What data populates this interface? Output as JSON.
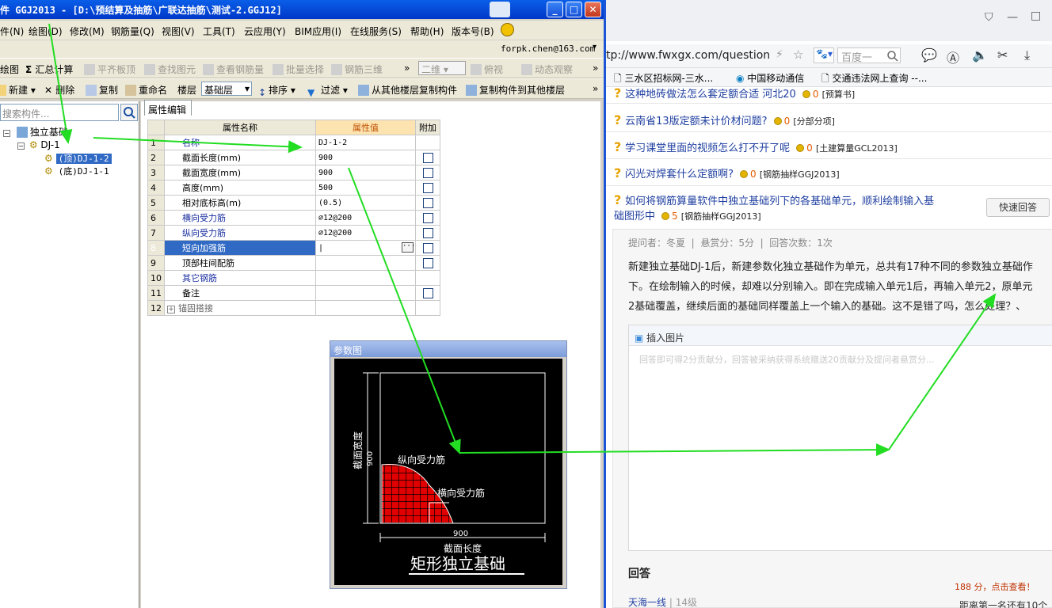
{
  "app": {
    "title": "件 GGJ2013 - [D:\\预结算及抽筋\\广联达抽筋\\测试-2.GGJ12]",
    "menu": [
      "件(N)",
      "绘图(D)",
      "修改(M)",
      "钢筋量(Q)",
      "视图(V)",
      "工具(T)",
      "云应用(Y)",
      "BIM应用(I)",
      "在线服务(S)",
      "帮助(H)",
      "版本号(B)"
    ],
    "account": "forpk.chen@163.com",
    "toolbar1": {
      "draw": "绘图",
      "summary_calc": "汇总计算",
      "flush_slab": "平齐板顶",
      "find_elem": "查找图元",
      "view_rebar": "查看钢筋量",
      "batch_select": "批量选择",
      "rebar_3d": "钢筋三维",
      "dim_mode": "二维",
      "view": "俯视",
      "dynamic_view": "动态观察"
    },
    "toolbar2": {
      "new": "新建",
      "delete": "删除",
      "copy": "复制",
      "rename": "重命名",
      "floor_label": "楼层",
      "floor_value": "基础层",
      "sort": "排序",
      "filter": "过滤",
      "copy_from_floor": "从其他楼层复制构件",
      "copy_to_floor": "复制构件到其他楼层"
    },
    "search_placeholder": "搜索构件...",
    "tree": {
      "root": "独立基础",
      "group": "DJ-1",
      "child1": "(顶)DJ-1-2",
      "child2": "(底)DJ-1-1"
    },
    "tab": "属性编辑",
    "table": {
      "headers": [
        "属性名称",
        "属性值",
        "附加"
      ],
      "rows": [
        {
          "no": "1",
          "name": "名称",
          "value": "DJ-1-2",
          "blue": true,
          "cb": false
        },
        {
          "no": "2",
          "name": "截面长度(mm)",
          "value": "900",
          "blue": false,
          "cb": true
        },
        {
          "no": "3",
          "name": "截面宽度(mm)",
          "value": "900",
          "blue": false,
          "cb": true
        },
        {
          "no": "4",
          "name": "高度(mm)",
          "value": "500",
          "blue": false,
          "cb": true
        },
        {
          "no": "5",
          "name": "相对底标高(m)",
          "value": "(0.5)",
          "blue": false,
          "cb": true
        },
        {
          "no": "6",
          "name": "横向受力筋",
          "value": "⌀12@200",
          "blue": true,
          "cb": true
        },
        {
          "no": "7",
          "name": "纵向受力筋",
          "value": "⌀12@200",
          "blue": true,
          "cb": true
        },
        {
          "no": "8",
          "name": "短向加强筋",
          "value": "",
          "blue": true,
          "cb": true
        },
        {
          "no": "9",
          "name": "顶部柱间配筋",
          "value": "",
          "blue": false,
          "cb": true
        },
        {
          "no": "10",
          "name": "其它钢筋",
          "value": "",
          "blue": true,
          "cb": false
        },
        {
          "no": "11",
          "name": "备注",
          "value": "",
          "blue": false,
          "cb": true
        },
        {
          "no": "12",
          "name": "锚固搭接",
          "value": "",
          "blue": false,
          "cb": false
        }
      ]
    },
    "param": {
      "title": "参数图",
      "width_label": "截面宽度",
      "width_value": "900",
      "long_rebar": "纵向受力筋",
      "trans_rebar": "横向受力筋",
      "length_value": "900",
      "length_label": "截面长度",
      "caption": "矩形独立基础"
    }
  },
  "browser": {
    "url": "tp://www.fwxgx.com/question",
    "search_placeholder": "百度一",
    "bookmarks": [
      "三水区招标网-三水...",
      "中国移动通信",
      "交通违法网上查询 --..."
    ],
    "top_partial": "这种地砖做法怎么套定额合适 河北20",
    "top_partial_count": "0",
    "top_partial_cat": "[预算书]",
    "questions": [
      {
        "title": "云南省13版定额未计价材问题?",
        "count": "0",
        "cat": "[分部分项]"
      },
      {
        "title": "学习课堂里面的视频怎么打不开了呢",
        "count": "0",
        "cat": "[土建算量GCL2013]"
      },
      {
        "title": "闪光对焊套什么定额啊?",
        "count": "0",
        "cat": "[钢筋抽样GGJ2013]"
      }
    ],
    "main_q": {
      "title_l1": "如何将钢筋算量软件中独立基础列下的各基础单元，顺利绘制输入基",
      "title_l2": "础图形中",
      "count": "5",
      "cat": "[钢筋抽样GGJ2013]"
    },
    "quick_answer": "快速回答",
    "meta": {
      "asker": "提问者：冬夏",
      "reward": "悬赏分：5分",
      "answers": "回答次数：1次"
    },
    "body": [
      "新建独立基础DJ-1后，新建参数化独立基础作为单元，总共有17种不同的参数独立基础作",
      "下。在绘制输入的时候，却难以分别输入。即在完成输入单元1后，再输入单元2，原单元",
      "2基础覆盖，继续后面的基础同样覆盖上一个输入的基础。这不是错了吗，怎么处理？、"
    ],
    "insert_image": "插入图片",
    "answer_placeholder": "回答即可得2分贡献分，回答被采纳获得系统赠送20贡献分及提问者悬赏分...",
    "answers_heading": "回答",
    "answerer": "天海一线",
    "answerer_level": "14级",
    "side_text1": "188 分，点击查看！",
    "side_text2": "距离第一名还有10个"
  },
  "colors": {
    "arrow": "#22dd22",
    "xp_title": "#0a5ee8",
    "selected": "#316ac5",
    "rebar_red": "#e00000"
  }
}
